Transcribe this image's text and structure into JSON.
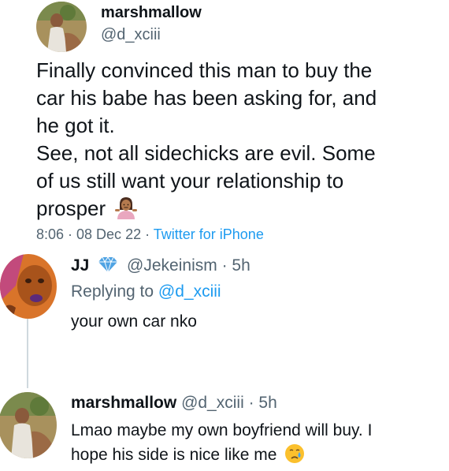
{
  "main_tweet": {
    "display_name": "marshmallow",
    "handle": "@d_xciii",
    "text_lines": [
      "Finally convinced this man to buy the",
      "car his babe has been asking for, and",
      "he got it.",
      "See, not all sidechicks are evil. Some",
      "of us still want your relationship to",
      "prosper"
    ],
    "emoji": "shrug-woman-emoji",
    "meta": "8:06 · 08 Dec 22 · ",
    "source": "Twitter for iPhone"
  },
  "reply_1": {
    "display_name": "JJ",
    "handle": "@Jekeinism",
    "time": "· 5h",
    "replying_prefix": "Replying to ",
    "replying_handle": "@d_xciii",
    "text": "your own car nko",
    "badge_icon": "diamond-icon"
  },
  "reply_2": {
    "display_name": "marshmallow",
    "handle": "@d_xciii",
    "time": "· 5h",
    "text_lines": [
      "Lmao maybe my own boyfriend will buy. I",
      "hope his side is nice like me"
    ],
    "emoji": "crying-face-emoji"
  },
  "colors": {
    "text": "#0f1419",
    "muted": "#536471",
    "link": "#1d9bf0",
    "thread_line": "#cfd9de",
    "diamond": "#4fa3e3"
  }
}
